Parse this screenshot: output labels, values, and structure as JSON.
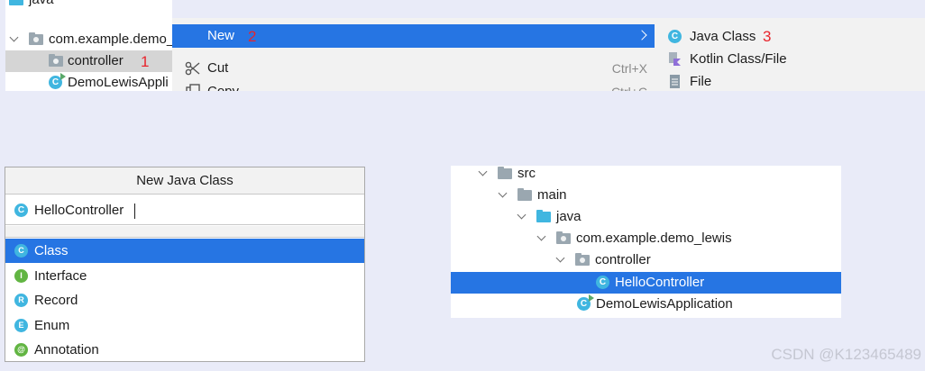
{
  "top_tree": {
    "java_label": "java",
    "package_label": "com.example.demo_",
    "controller_label": "controller",
    "app_label": "DemoLewisAppli",
    "step1": "1"
  },
  "context_menu": {
    "new_label": "New",
    "step2": "2",
    "cut_label": "Cut",
    "cut_shortcut": "Ctrl+X",
    "copy_label": "Copy",
    "copy_shortcut": "Ctrl+C"
  },
  "submenu": {
    "java_class_label": "Java Class",
    "step3": "3",
    "kotlin_label": "Kotlin Class/File",
    "file_label": "File"
  },
  "dialog": {
    "title": "New Java Class",
    "name_value": "HelloController",
    "kinds": [
      {
        "label": "Class",
        "letter": "C",
        "color": "#40b6e0"
      },
      {
        "label": "Interface",
        "letter": "I",
        "color": "#62b543"
      },
      {
        "label": "Record",
        "letter": "R",
        "color": "#40b6e0"
      },
      {
        "label": "Enum",
        "letter": "E",
        "color": "#40b6e0"
      },
      {
        "label": "Annotation",
        "letter": "@",
        "color": "#62b543"
      }
    ]
  },
  "result_tree": {
    "src": "src",
    "main": "main",
    "java": "java",
    "package": "com.example.demo_lewis",
    "controller": "controller",
    "hello": "HelloController",
    "app": "DemoLewisApplication"
  },
  "watermark": "CSDN @K123465489",
  "colors": {
    "selection_blue": "#2675e3",
    "class_icon": "#40b6e0",
    "step_red": "#e8242c"
  }
}
